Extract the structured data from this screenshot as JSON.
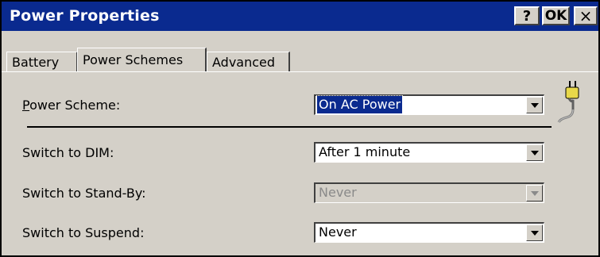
{
  "window": {
    "title": "Power Properties",
    "help_label": "?",
    "ok_label": "OK",
    "close_label": "×"
  },
  "tabs": [
    {
      "label": "Battery",
      "selected": false
    },
    {
      "label": "Power Schemes",
      "selected": true
    },
    {
      "label": "Advanced",
      "selected": false
    }
  ],
  "form": {
    "power_scheme": {
      "label_prefix": "",
      "label_accel": "P",
      "label_rest": "ower Scheme:",
      "value": "On AC Power"
    },
    "switch_dim": {
      "label": "Switch to DIM:",
      "value": "After 1 minute",
      "enabled": true
    },
    "switch_standby": {
      "label": "Switch to Stand-By:",
      "value": "Never",
      "enabled": false
    },
    "switch_suspend": {
      "label": "Switch to Suspend:",
      "value": "Never",
      "enabled": true
    }
  },
  "icons": {
    "plug": "ac-power-plug-icon",
    "dropdown": "chevron-down-icon"
  },
  "colors": {
    "titlebar": "#0a2a8f",
    "face": "#d4d0c8",
    "selection": "#0a2a8f",
    "disabled_text": "#8a8a8a"
  }
}
